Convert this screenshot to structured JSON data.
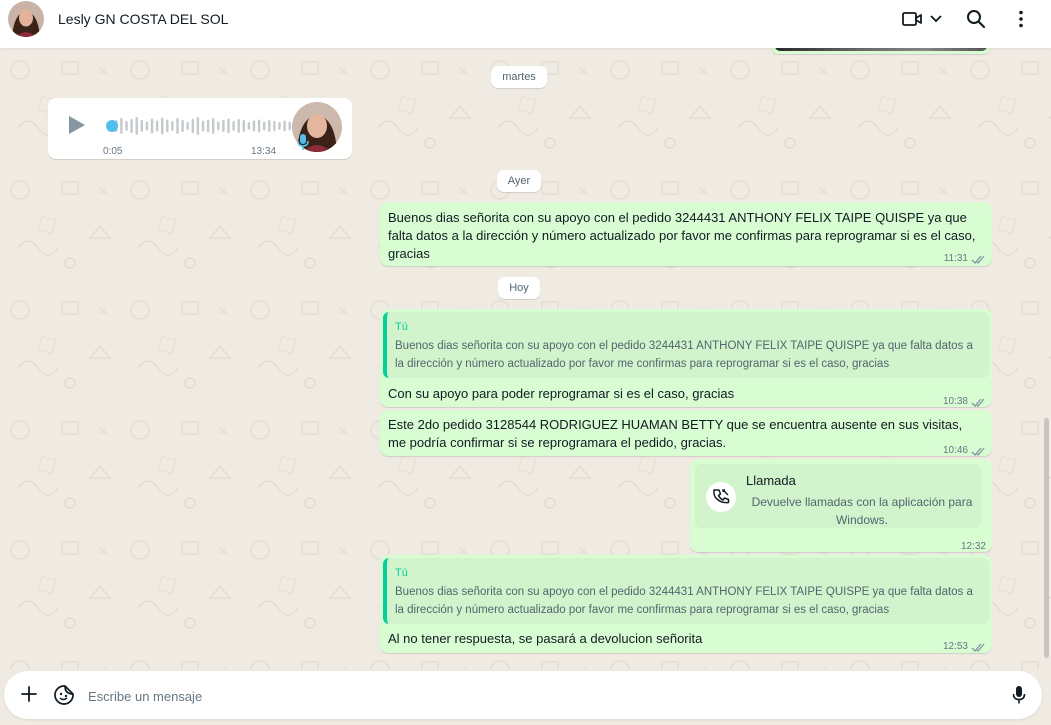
{
  "header": {
    "contact_name": "Lesly GN COSTA DEL SOL"
  },
  "dates": {
    "martes": "martes",
    "ayer": "Ayer",
    "hoy": "Hoy"
  },
  "voice_note": {
    "duration": "0:05",
    "time": "13:34",
    "progress": 0.0
  },
  "messages": {
    "m1": {
      "text": "Buenos dias señorita con su apoyo con el pedido 3244431 ANTHONY FELIX TAIPE QUISPE ya que falta datos a la dirección  y número actualizado por favor me confirmas para reprogramar si es el caso, gracias",
      "time": "11:31"
    },
    "m2": {
      "quote_author": "Tú",
      "quote_text": "Buenos dias señorita con su apoyo con el pedido 3244431 ANTHONY FELIX TAIPE QUISPE ya que falta datos a la dirección  y número actualizado por favor me confirmas para reprogramar si es el caso, gracias",
      "text": "Con su apoyo para poder reprogramar si es el caso, gracias",
      "time": "10:38"
    },
    "m3": {
      "text": "Este 2do pedido 3128544 RODRIGUEZ HUAMAN BETTY que se encuentra ausente en sus visitas, me podría confirmar si se reprogramara el pedido, gracias.",
      "time": "10:46"
    },
    "m4": {
      "call_title": "Llamada",
      "call_sub": "Devuelve llamadas con la aplicación para Windows.",
      "time": "12:32"
    },
    "m5": {
      "quote_author": "Tú",
      "quote_text": "Buenos dias señorita con su apoyo con el pedido 3244431 ANTHONY FELIX TAIPE QUISPE ya que falta datos a la dirección  y número actualizado por favor me confirmas para reprogramar si es el caso, gracias",
      "text": "Al no tener respuesta, se pasará a devolucion señorita",
      "time": "12:53"
    }
  },
  "composer": {
    "placeholder": "Escribe un mensaje",
    "value": ""
  },
  "icons": {
    "video_call": "video-camera-icon",
    "dropdown": "chevron-down-icon",
    "search": "search-icon",
    "menu": "more-vertical-icon",
    "attach": "plus-icon",
    "emoji": "sticker-emoji-icon",
    "mic": "microphone-icon",
    "read": "double-check-icon",
    "call": "missed-call-icon",
    "play": "play-icon"
  },
  "colors": {
    "outgoing_bubble": "#d9fdd3",
    "incoming_bubble": "#ffffff",
    "quote_bar": "#06cf9c",
    "background": "#efeae2",
    "voice_accent": "#53bdeb"
  }
}
